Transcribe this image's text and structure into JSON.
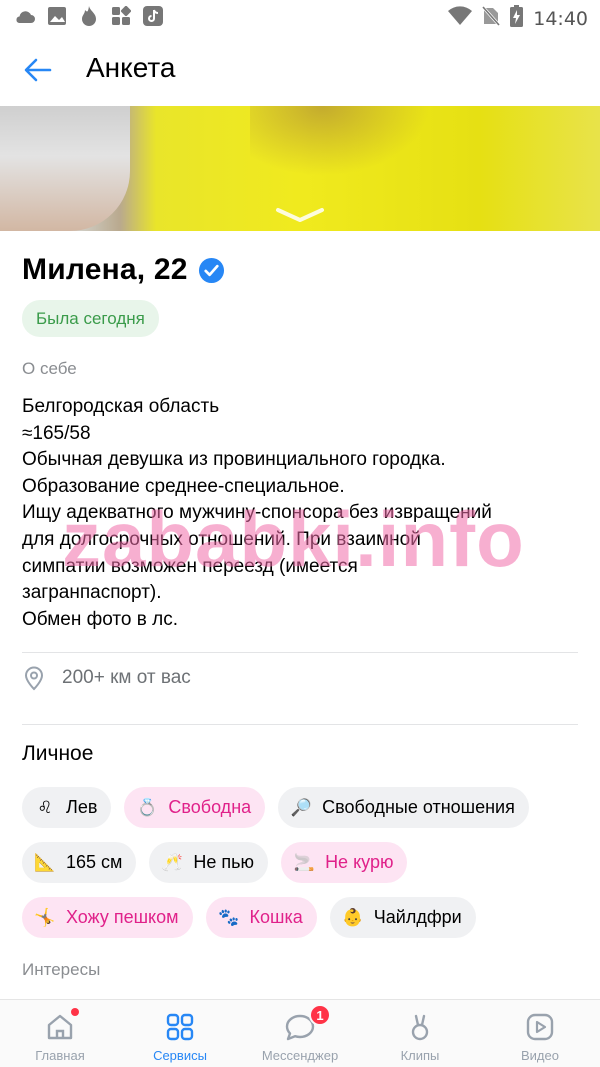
{
  "status_bar": {
    "time": "14:40",
    "left_icons": [
      "cloud-icon",
      "image-icon",
      "fire-icon",
      "apps-icon",
      "tiktok-icon"
    ],
    "right_icons": [
      "wifi-icon",
      "no-sim-icon",
      "battery-charging-icon"
    ]
  },
  "app_bar": {
    "title": "Анкета"
  },
  "profile": {
    "name_age": "Милена, 22",
    "online_status": "Была сегодня",
    "about_label": "О себе",
    "about_lines": [
      "Белгородская область",
      "≈165/58",
      "Обычная девушка из провинциального городка.",
      "Образование среднее-специальное.",
      "Ищу адекватного мужчину-спонсора без извращений",
      "для долгосрочных отношений. При взаимной",
      "симпатии возможен переезд (имеется",
      "загранпаспорт).",
      "Обмен фото в лс."
    ],
    "distance": "200+ км от вас"
  },
  "personal": {
    "title": "Личное",
    "rows": [
      [
        {
          "icon": "♌",
          "label": "Лев",
          "highlight": false
        },
        {
          "icon": "💍",
          "label": "Свободна",
          "highlight": true
        },
        {
          "icon": "🔎",
          "label": "Свободные отношения",
          "highlight": false
        }
      ],
      [
        {
          "icon": "📐",
          "label": "165 см",
          "highlight": false
        },
        {
          "icon": "🥂",
          "label": "Не пью",
          "highlight": false
        },
        {
          "icon": "🚬",
          "label": "Не курю",
          "highlight": true
        }
      ],
      [
        {
          "icon": "🤸",
          "label": "Хожу пешком",
          "highlight": true
        },
        {
          "icon": "🐾",
          "label": "Кошка",
          "highlight": true
        },
        {
          "icon": "👶",
          "label": "Чайлдфри",
          "highlight": false
        }
      ]
    ]
  },
  "interests": {
    "title": "Интересы"
  },
  "watermark": "zababki.info",
  "tab_bar": {
    "tabs": [
      {
        "label": "Главная",
        "icon": "home-icon"
      },
      {
        "label": "Сервисы",
        "icon": "services-icon"
      },
      {
        "label": "Мессенджер",
        "icon": "messenger-icon",
        "badge": "1"
      },
      {
        "label": "Клипы",
        "icon": "clips-icon"
      },
      {
        "label": "Видео",
        "icon": "video-icon"
      }
    ]
  },
  "colors": {
    "accent": "#2787f5",
    "online_green": "#3a9b4a",
    "online_bg": "#e8f5ea",
    "chip_pink_text": "#e0218a",
    "chip_pink_bg": "#fde4f3",
    "chip_bg": "#f0f1f3",
    "badge_red": "#ff3347"
  }
}
